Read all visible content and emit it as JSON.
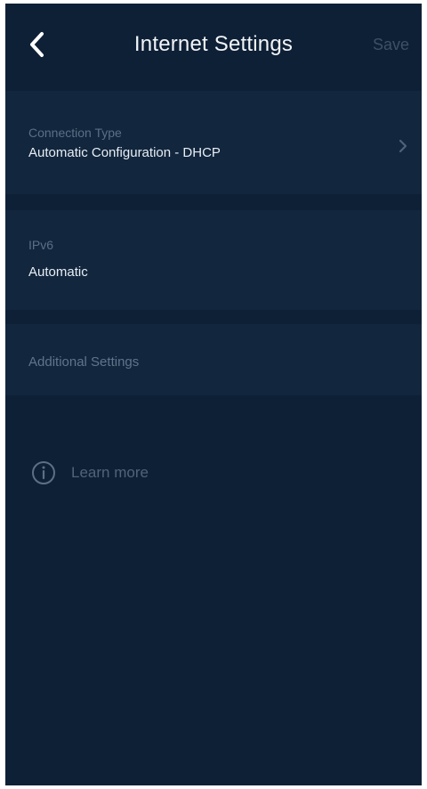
{
  "header": {
    "title": "Internet Settings",
    "save_label": "Save",
    "back_icon": "chevron-left-icon"
  },
  "connection": {
    "label": "Connection Type",
    "value": "Automatic Configuration - DHCP",
    "icon": "chevron-right-icon"
  },
  "ipv6": {
    "label": "IPv6",
    "value": "Automatic"
  },
  "additional": {
    "label": "Additional Settings"
  },
  "learn_more": {
    "label": "Learn more",
    "icon": "info-icon"
  },
  "colors": {
    "background": "#0e2036",
    "section": "#12263d",
    "muted_text": "#5b6f85",
    "save_disabled": "#3c5066"
  }
}
